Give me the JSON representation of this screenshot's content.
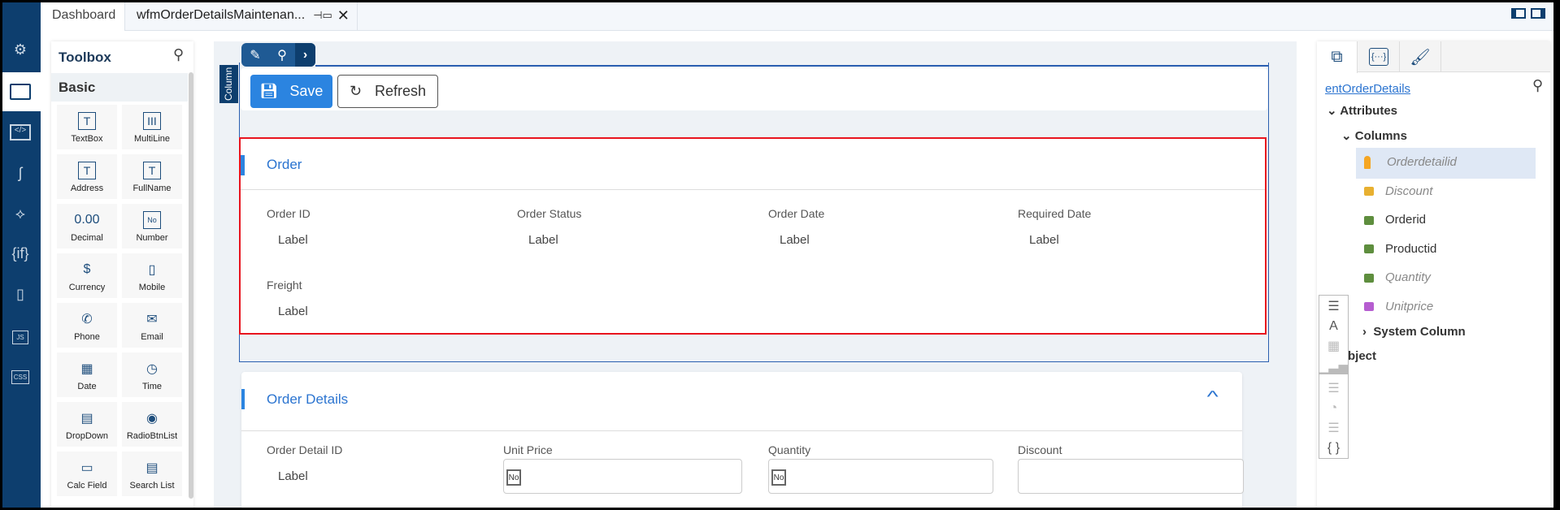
{
  "tabs": [
    {
      "label": "Dashboard"
    },
    {
      "label": "wfmOrderDetailsMaintenan..."
    }
  ],
  "nav": [
    "settings-icon",
    "form-icon",
    "code-icon",
    "hook-icon",
    "workflow-icon",
    "if-icon",
    "tablet-icon",
    "js-icon",
    "css-icon"
  ],
  "nav_text": {
    "if": "{if}",
    "js": "JS",
    "css": "CSS"
  },
  "toolbox": {
    "title": "Toolbox",
    "section": "Basic",
    "items": [
      {
        "label": "TextBox",
        "glyph": "T"
      },
      {
        "label": "MultiLine",
        "glyph": "III"
      },
      {
        "label": "Address",
        "glyph": "T"
      },
      {
        "label": "FullName",
        "glyph": "T"
      },
      {
        "label": "Decimal",
        "glyph": "0.00"
      },
      {
        "label": "Number",
        "glyph": "No"
      },
      {
        "label": "Currency",
        "glyph": "$"
      },
      {
        "label": "Mobile",
        "glyph": "▯"
      },
      {
        "label": "Phone",
        "glyph": "✆"
      },
      {
        "label": "Email",
        "glyph": "✉"
      },
      {
        "label": "Date",
        "glyph": "▦"
      },
      {
        "label": "Time",
        "glyph": "◷"
      },
      {
        "label": "DropDown",
        "glyph": "▤"
      },
      {
        "label": "RadioBtnList",
        "glyph": "◉"
      },
      {
        "label": "Calc Field",
        "glyph": "▭"
      },
      {
        "label": "Search List",
        "glyph": "▤"
      }
    ]
  },
  "canvas": {
    "column_tag": "Column",
    "save": "Save",
    "refresh": "Refresh",
    "order": {
      "title": "Order",
      "fields": [
        {
          "label": "Order ID",
          "value": "Label"
        },
        {
          "label": "Order Status",
          "value": "Label"
        },
        {
          "label": "Order Date",
          "value": "Label"
        },
        {
          "label": "Required Date",
          "value": "Label"
        },
        {
          "label": "Freight",
          "value": "Label"
        }
      ]
    },
    "details": {
      "title": "Order Details",
      "fields": [
        {
          "label": "Order Detail ID",
          "value": "Label"
        },
        {
          "label": "Unit Price",
          "badge": "No"
        },
        {
          "label": "Quantity",
          "badge": "No"
        },
        {
          "label": "Discount"
        }
      ]
    }
  },
  "right": {
    "entity": "entOrderDetails",
    "attributes": "Attributes",
    "columns": "Columns",
    "cols": [
      {
        "name": "Orderdetailid",
        "color": "#f5a623"
      },
      {
        "name": "Discount",
        "color": "#e8b030"
      },
      {
        "name": "Orderid",
        "color": "#5e8e3e"
      },
      {
        "name": "Productid",
        "color": "#5e8e3e"
      },
      {
        "name": "Quantity",
        "color": "#5e8e3e"
      },
      {
        "name": "Unitprice",
        "color": "#b65dd0"
      }
    ],
    "system": "System Column",
    "object": "bject",
    "braces": "{ }"
  }
}
